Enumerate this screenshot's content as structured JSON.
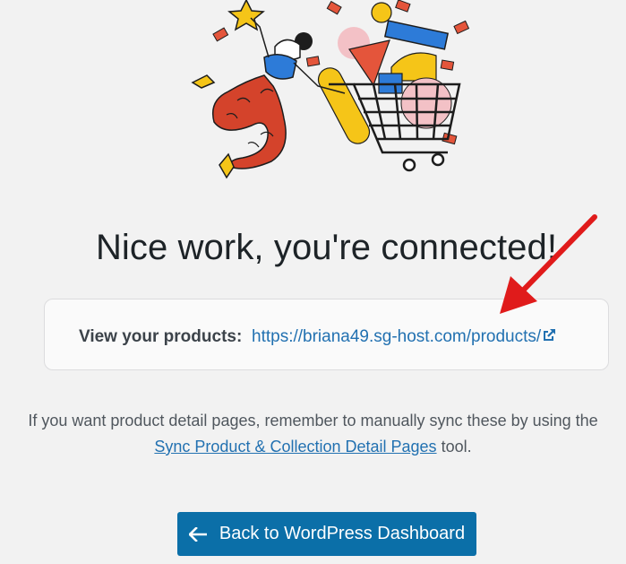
{
  "page": {
    "headline": "Nice work, you're connected!",
    "products_label": "View your products:",
    "products_url": "https://briana49.sg-host.com/products/",
    "note_before_link": "If you want product detail pages, remember to manually sync these by using the",
    "note_link_text": "Sync Product & Collection Detail Pages",
    "note_after_link": "tool.",
    "back_button_label": "Back to WordPress Dashboard"
  },
  "icons": {
    "external_link": "external-link-icon",
    "back_arrow": "arrow-left-icon",
    "annotation_arrow": "red-arrow-annotation"
  },
  "colors": {
    "background": "#f2f2f2",
    "link": "#2271b1",
    "button": "#0b6fa8",
    "annotation": "#e01b1b"
  }
}
